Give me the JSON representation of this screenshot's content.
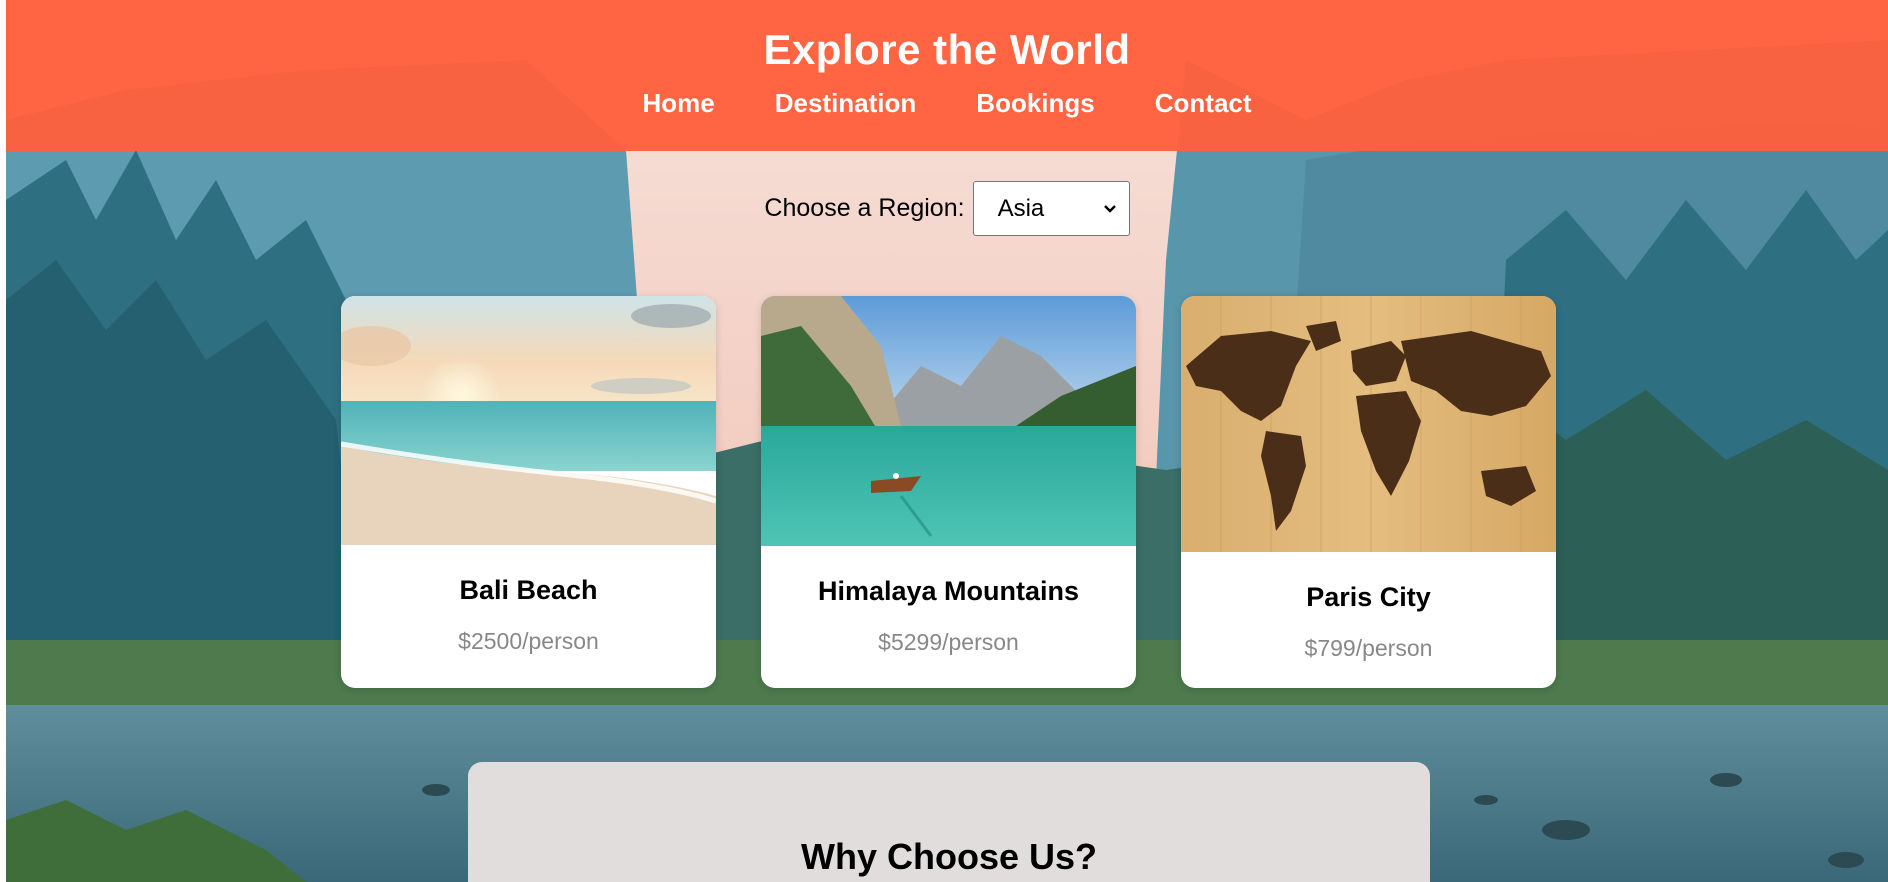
{
  "header": {
    "title": "Explore the World",
    "nav": [
      "Home",
      "Destination",
      "Bookings",
      "Contact"
    ],
    "color": "#ff603c"
  },
  "region": {
    "label": "Choose a Region:",
    "selected": "Asia"
  },
  "cards": [
    {
      "name": "Bali Beach",
      "price": "$2500/person",
      "image": "beach-sunset"
    },
    {
      "name": "Himalaya Mountains",
      "price": "$5299/person",
      "image": "mountain-lake"
    },
    {
      "name": "Paris City",
      "price": "$799/person",
      "image": "wooden-world-map"
    }
  ],
  "why": {
    "heading": "Why Choose Us?"
  }
}
